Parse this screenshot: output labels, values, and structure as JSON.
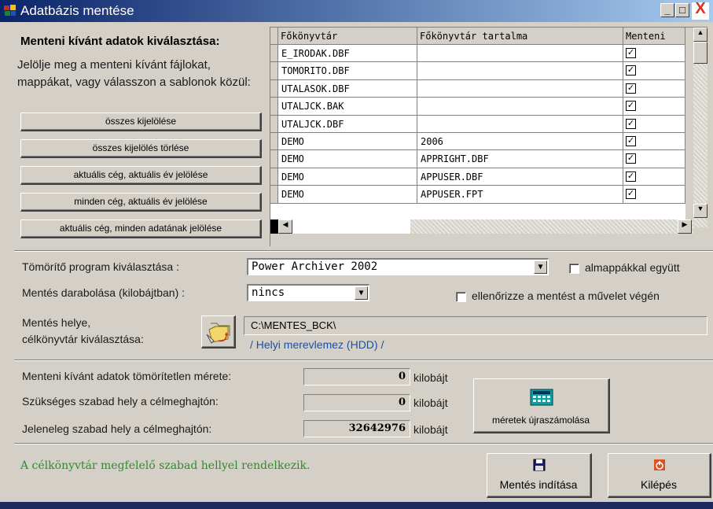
{
  "window": {
    "title": "Adatbázis mentése",
    "minimize": "_",
    "maximize": "□",
    "close": "X"
  },
  "left": {
    "heading": "Menteni kívánt adatok kiválasztása:",
    "description": "Jelölje meg a menteni kívánt fájlokat, mappákat, vagy válasszon a sablonok közül:",
    "buttons": [
      "összes kijelölése",
      "összes kijelölés törlése",
      "aktuális cég, aktuális év jelölése",
      "minden cég, aktuális év jelölése",
      "aktuális cég, minden adatának jelölése"
    ]
  },
  "grid": {
    "columns": [
      "Főkönyvtár",
      "Főkönyvtár tartalma",
      "Menteni"
    ],
    "rows": [
      {
        "dir": "E_IRODAK.DBF",
        "content": "",
        "save": "✓"
      },
      {
        "dir": "TOMORITO.DBF",
        "content": "",
        "save": "✓"
      },
      {
        "dir": "UTALASOK.DBF",
        "content": "",
        "save": "✓"
      },
      {
        "dir": "UTALJCK.BAK",
        "content": "",
        "save": "✓"
      },
      {
        "dir": "UTALJCK.DBF",
        "content": "",
        "save": "✓"
      },
      {
        "dir": "DEMO",
        "content": "2006",
        "save": "✓"
      },
      {
        "dir": "DEMO",
        "content": "APPRIGHT.DBF",
        "save": "✓"
      },
      {
        "dir": "DEMO",
        "content": "APPUSER.DBF",
        "save": "✓"
      },
      {
        "dir": "DEMO",
        "content": "APPUSER.FPT",
        "save": "✓"
      }
    ]
  },
  "compress": {
    "label": "Tömörítő program kiválasztása :",
    "value": "Power Archiver 2002",
    "subfolders_label": "almappákkal együtt"
  },
  "split": {
    "label": "Mentés darabolása (kilobájtban) :",
    "value": "nincs",
    "verify_label": "ellenőrizze a mentést a művelet végén"
  },
  "target": {
    "label_line1": "Mentés helye,",
    "label_line2": "célkönyvtár kiválasztása:",
    "path": "C:\\MENTES_BCK\\",
    "drive": "/ Helyi merevlemez (HDD) /"
  },
  "sizes": {
    "uncompressed_label": "Menteni kívánt adatok tömörítetlen mérete:",
    "uncompressed_value": "0",
    "required_label": "Szükséges szabad hely a célmeghajtón:",
    "required_value": "0",
    "free_label": "Jeleneleg szabad hely a célmeghajtón:",
    "free_value": "32642976",
    "unit": "kilobájt",
    "recalc_button": "méretek újraszámolása"
  },
  "status": {
    "message": "A célkönyvtár megfelelő szabad hellyel rendelkezik."
  },
  "actions": {
    "start_label": "Mentés indítása",
    "exit_label": "Kilépés"
  },
  "colors": {
    "status_text": "#2e8b2e",
    "drive_text": "#1f4fa0",
    "titlebar": "#0a246a"
  }
}
